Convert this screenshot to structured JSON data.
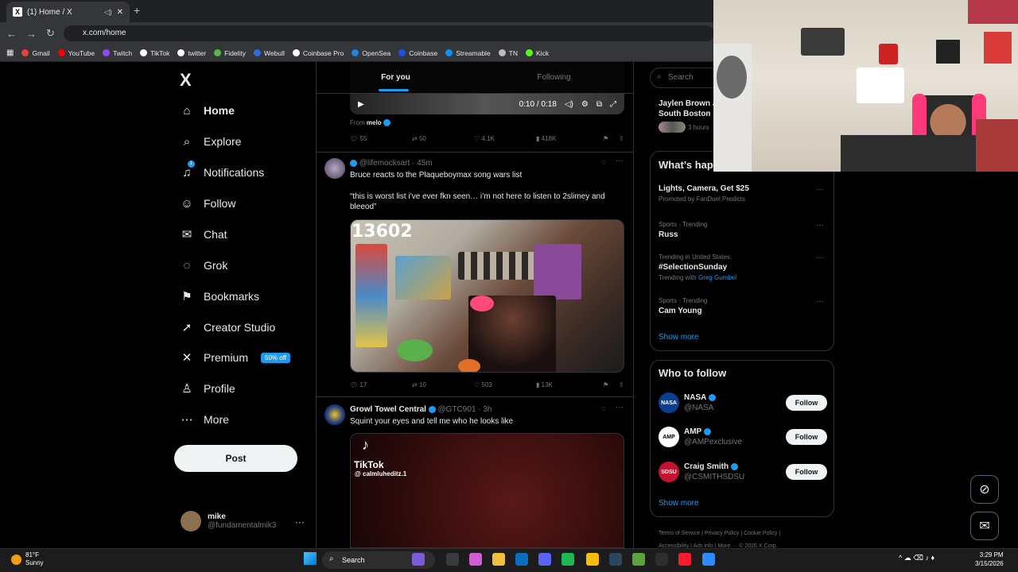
{
  "browser": {
    "tab_title": "(1) Home / X",
    "new_tab": "+",
    "url": "x.com/home",
    "bookmarks": [
      "Gmail",
      "YouTube",
      "Twitch",
      "TikTok",
      "twitter",
      "Fidelity",
      "Webull",
      "Coinbase Pro",
      "OpenSea",
      "Coinbase",
      "Streamable",
      "TN",
      "Kick"
    ],
    "bookmark_colors": [
      "#ea4335",
      "#ff0000",
      "#9146ff",
      "#ffffff",
      "#ffffff",
      "#57b847",
      "#2d6cdf",
      "#ffffff",
      "#2081e2",
      "#1652f0",
      "#0f90fa",
      "#bbbbbb",
      "#53fc18"
    ]
  },
  "sidebar": {
    "logo": "X",
    "items": [
      {
        "label": "Home",
        "icon": "⌂"
      },
      {
        "label": "Explore",
        "icon": "⌕"
      },
      {
        "label": "Notifications",
        "icon": "♫"
      },
      {
        "label": "Follow",
        "icon": "☺"
      },
      {
        "label": "Chat",
        "icon": "✉"
      },
      {
        "label": "Grok",
        "icon": "◌"
      },
      {
        "label": "Bookmarks",
        "icon": "⚑"
      },
      {
        "label": "Creator Studio",
        "icon": "➚"
      },
      {
        "label": "Premium",
        "icon": "✕"
      },
      {
        "label": "Profile",
        "icon": "♙"
      },
      {
        "label": "More",
        "icon": "⋯"
      }
    ],
    "notification_badge": "1",
    "premium_badge": "50% off",
    "post_label": "Post",
    "user": {
      "name": "mike",
      "handle": "@fundamentalmik3",
      "more": "···"
    }
  },
  "feed": {
    "tabs": [
      "For you",
      "Following"
    ],
    "video": {
      "time": "0:10 / 0:18",
      "play": "▶"
    },
    "from_label": "From",
    "from_name": "melo",
    "post0_actions": {
      "replies": "55",
      "reposts": "50",
      "likes": "4.1K",
      "views": "418K"
    },
    "post1": {
      "handle": "@lifemocksart",
      "time": "· 45m",
      "text1": "Bruce reacts to the Plaqueboymax song wars list",
      "text2": "“this is worst list i’ve ever fkn seen… i’m not here to listen to 2slimey and bleeod”",
      "image_counter": "13602",
      "actions": {
        "replies": "17",
        "reposts": "10",
        "likes": "503",
        "views": "13K"
      }
    },
    "post2": {
      "name": "Growl Towel Central",
      "handle": "@GTC901",
      "time": "· 3h",
      "text": "Squint your eyes and tell me who he looks like",
      "tiktok_label": "TikTok",
      "tiktok_user": "@ calmluheditz.1"
    }
  },
  "right": {
    "search_placeholder": "Search",
    "top_trend": {
      "line1": "Jaylen Brown J",
      "line2": "South Boston I",
      "meta": "3 hours"
    },
    "whats_title": "What’s hap",
    "trends": [
      {
        "meta": "",
        "title": "Lights, Camera, Get $25",
        "sub": "Promoted by FanDuel Predicts"
      },
      {
        "meta": "Sports · Trending",
        "title": "Russ",
        "sub": ""
      },
      {
        "meta": "Trending in United States",
        "title": "#SelectionSunday",
        "sub": "Trending with",
        "sub_link": "Greg Gumbel"
      },
      {
        "meta": "Sports · Trending",
        "title": "Cam Young",
        "sub": ""
      }
    ],
    "show_more": "Show more",
    "who_title": "Who to follow",
    "follow_suggestions": [
      {
        "name": "NASA",
        "handle": "@NASA",
        "avatar": "NASA",
        "color": "#0b3d91"
      },
      {
        "name": "AMP",
        "handle": "@AMPexclusive",
        "avatar": "AMP",
        "color": "#ffffff"
      },
      {
        "name": "Craig Smith",
        "handle": "@CSMITHSDSU",
        "avatar": "SDSU",
        "color": "#c41230"
      }
    ],
    "follow_label": "Follow",
    "footer_row1": "Terms of Service  |  Privacy Policy  |  Cookie Policy  |",
    "footer_row2": "Accessibility  |  Ads info  |  More ···  © 2026 X Corp."
  },
  "taskbar": {
    "weather_temp": "81°F",
    "weather_desc": "Sunny",
    "search_label": "Search",
    "time": "3:29 PM",
    "date": "3/15/2026",
    "tray": "^  ☁  ⌫  ♪  ♦"
  }
}
